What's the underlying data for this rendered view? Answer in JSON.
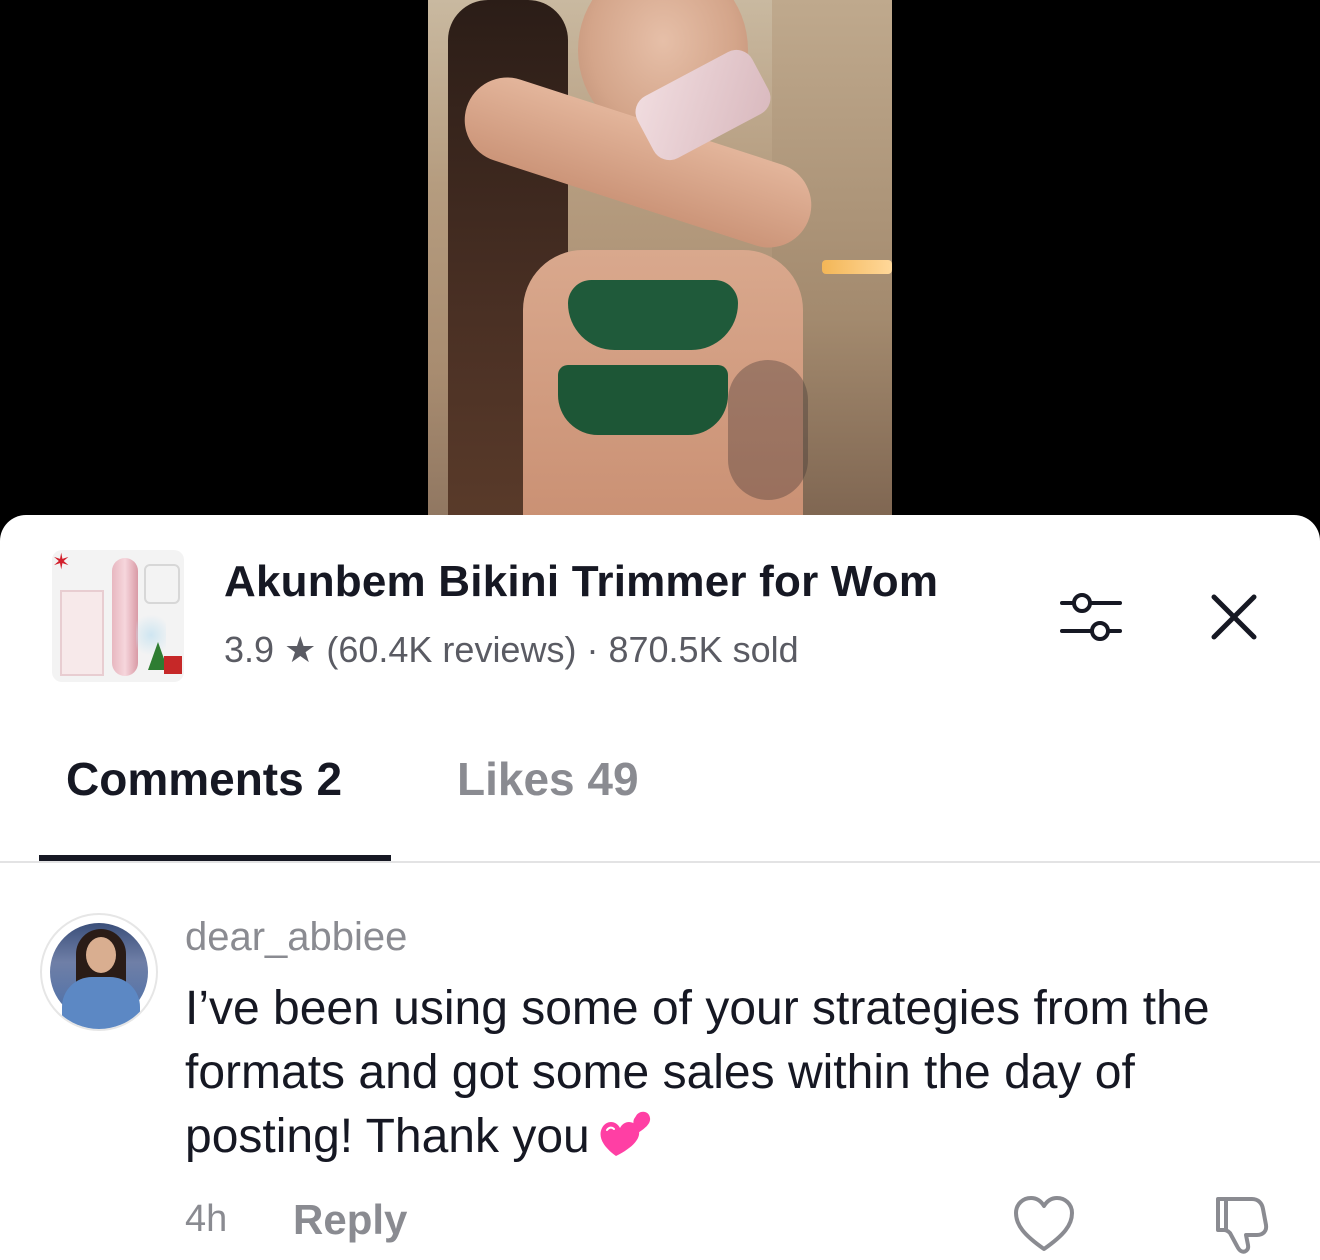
{
  "product": {
    "title": "Akunbem Bikini Trimmer for Wom",
    "rating": "3.9",
    "star": "★",
    "reviews": "(60.4K reviews)",
    "separator": "·",
    "sold": "870.5K sold"
  },
  "tabs": [
    {
      "label": "Comments 2",
      "active": true
    },
    {
      "label": "Likes 49",
      "active": false
    }
  ],
  "comments": [
    {
      "username": "dear_abbiee",
      "text": "I’ve been using some of your strategies from the formats and got some sales within the day of posting! Thank you",
      "emoji": "two-hearts",
      "time": "4h",
      "reply_label": "Reply"
    }
  ],
  "colors": {
    "text_primary": "#161823",
    "text_secondary": "#8a8b91",
    "heart_pink": "#ff3fa4"
  },
  "icons": {
    "filter": "sliders-icon",
    "close": "close-icon",
    "like": "heart-outline-icon",
    "dislike": "thumbs-down-icon"
  }
}
